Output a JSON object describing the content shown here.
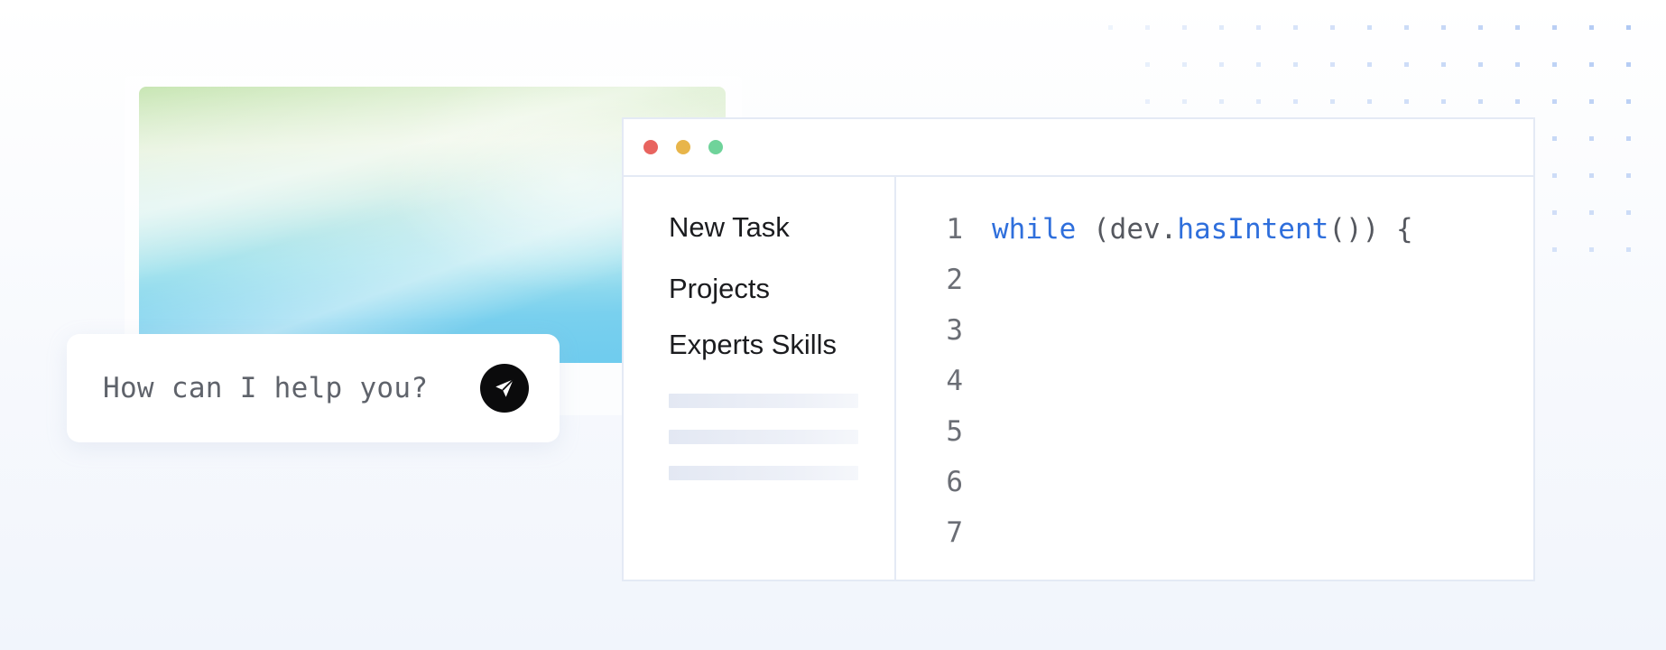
{
  "chat": {
    "placeholder": "How can I help you?"
  },
  "icons": {
    "send": "paper-plane-icon"
  },
  "window": {
    "traffic_lights": [
      {
        "name": "close",
        "color": "#e8645f"
      },
      {
        "name": "minimize",
        "color": "#e8b54a"
      },
      {
        "name": "maximize",
        "color": "#6fd39a"
      }
    ]
  },
  "sidebar": {
    "items": [
      {
        "label": "New Task"
      },
      {
        "label": "Projects"
      },
      {
        "label": "Experts Skills"
      }
    ]
  },
  "editor": {
    "line_numbers": [
      "1",
      "2",
      "3",
      "4",
      "5",
      "6",
      "7"
    ],
    "code_line_1": {
      "keyword": "while",
      "open": " (dev.",
      "method": "hasIntent",
      "close": "()) {"
    }
  },
  "colors": {
    "keyword": "#2f6fdc",
    "text": "#55585f",
    "border": "#e4eaf5"
  }
}
